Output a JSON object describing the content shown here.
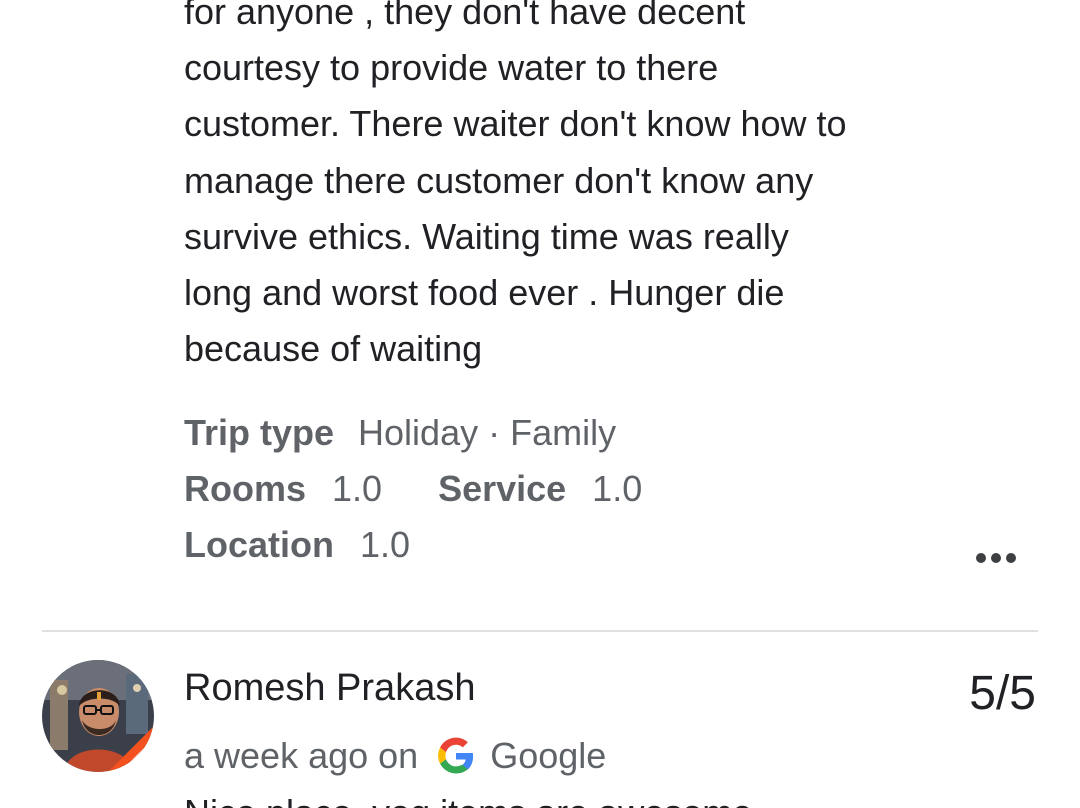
{
  "review1": {
    "text_lines": [
      "for anyone , they don't have decent",
      "courtesy to provide water to there",
      "customer. There waiter don't know how to",
      "manage there customer don't know any",
      "survive ethics. Waiting time was really",
      "long and worst food ever . Hunger die",
      "because of waiting"
    ],
    "trip_type_label": "Trip type",
    "trip_type_value": "Holiday · Family",
    "rooms_label": "Rooms",
    "rooms_value": "1.0",
    "service_label": "Service",
    "service_value": "1.0",
    "location_label": "Location",
    "location_value": "1.0",
    "more_icon": "more-horiz-icon"
  },
  "review2": {
    "name": "Romesh Prakash",
    "score": "5/5",
    "time": "a week ago on",
    "source": "Google",
    "source_icon": "google-g-icon",
    "text_start": "Nice place, veg items are awesome"
  },
  "colors": {
    "text_primary": "#202124",
    "text_secondary": "#5f6368",
    "divider": "#e0e0e0",
    "badge_orange": "#f4511e"
  }
}
